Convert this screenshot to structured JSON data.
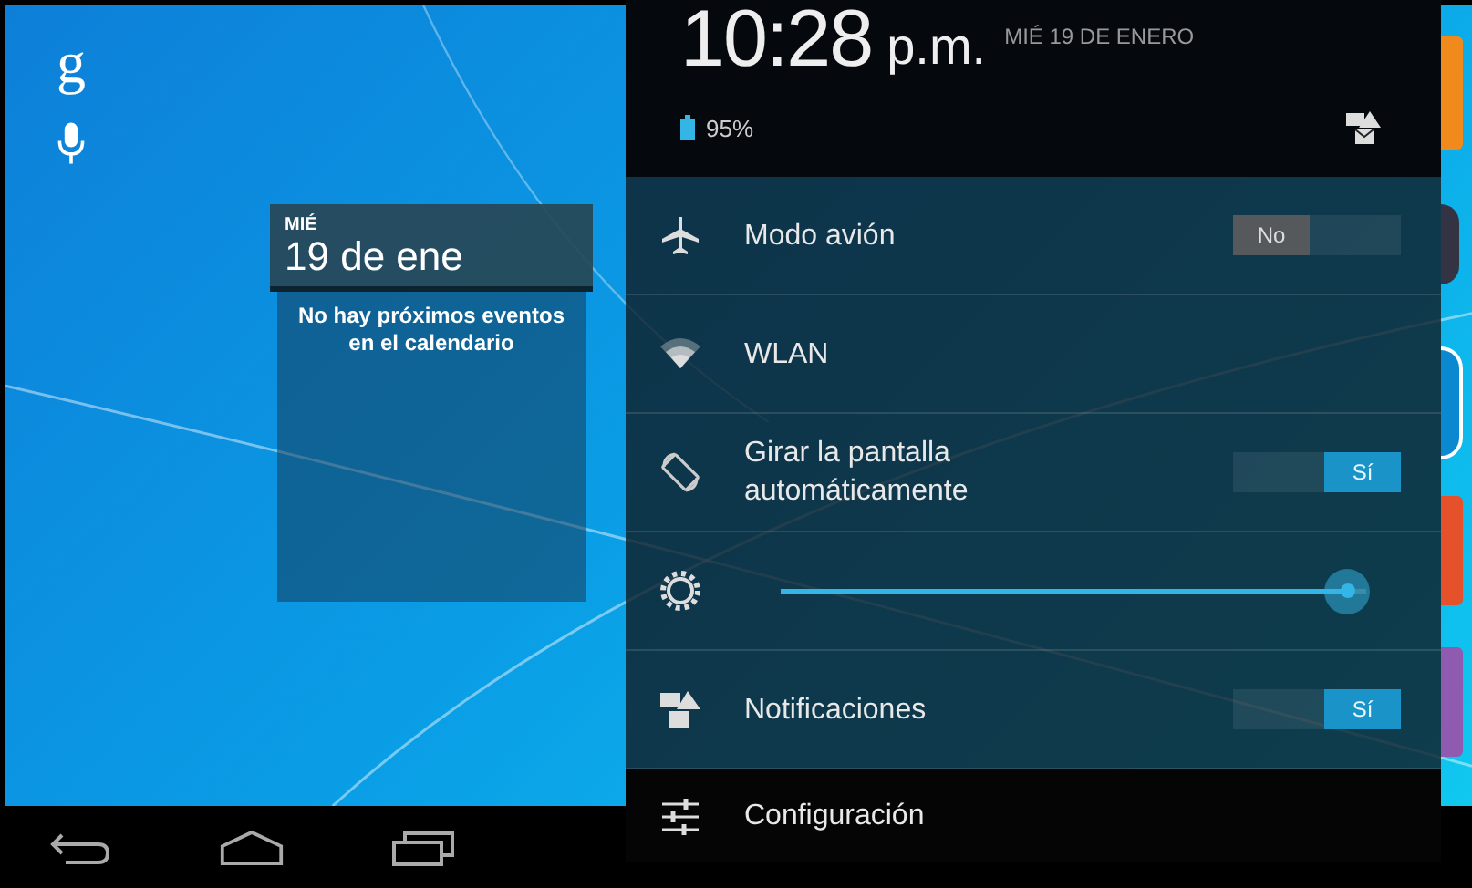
{
  "home": {
    "search_glyph": "g"
  },
  "calendar_widget": {
    "day": "MIÉ",
    "date": "19 de ene",
    "message": "No hay próximos eventos en el calendario"
  },
  "quick_settings": {
    "time": "10:28",
    "ampm": "p.m.",
    "date": "MIÉ 19 DE ENERO",
    "battery": "95%",
    "items": [
      {
        "kind": "toggle",
        "label": "Modo avión",
        "on": false,
        "switch_label": "No"
      },
      {
        "kind": "plain",
        "label": "WLAN"
      },
      {
        "kind": "toggle",
        "label": "Girar la pantalla automáticamente",
        "on": true,
        "switch_label": "Sí"
      },
      {
        "kind": "slider",
        "level": 0.97
      },
      {
        "kind": "toggle",
        "label": "Notificaciones",
        "on": true,
        "switch_label": "Sí"
      },
      {
        "kind": "link",
        "label": "Configuración"
      }
    ]
  }
}
